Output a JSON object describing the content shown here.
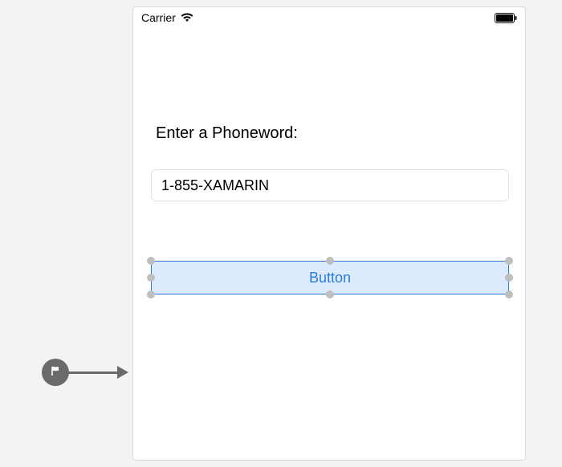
{
  "status_bar": {
    "carrier": "Carrier"
  },
  "form": {
    "title": "Enter a Phoneword:",
    "input_value": "1-855-XAMARIN",
    "button_label": "Button"
  }
}
